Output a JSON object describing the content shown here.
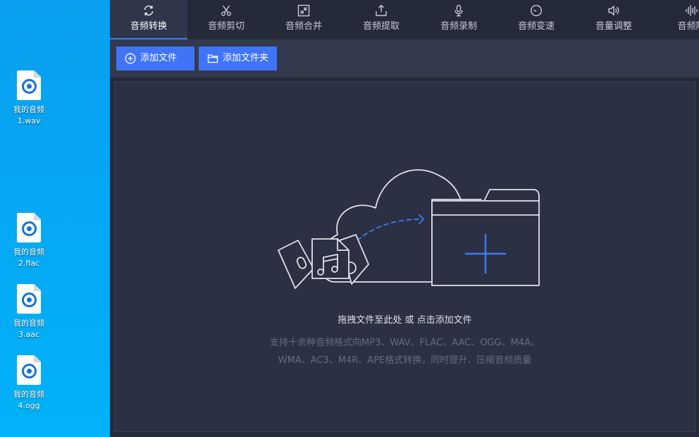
{
  "desktop": {
    "icons": [
      {
        "name": "我的音频\n1.wav"
      },
      {
        "name": "我的音频\n2.flac"
      },
      {
        "name": "我的音频\n3.aac"
      },
      {
        "name": "我的音频\n4.ogg"
      }
    ]
  },
  "tabs": [
    {
      "label": "音频转换",
      "icon": "convert-icon",
      "active": true
    },
    {
      "label": "音频剪切",
      "icon": "scissors-icon"
    },
    {
      "label": "音频合并",
      "icon": "merge-icon"
    },
    {
      "label": "音频提取",
      "icon": "extract-icon"
    },
    {
      "label": "音频录制",
      "icon": "microphone-icon"
    },
    {
      "label": "音频变速",
      "icon": "speed-icon"
    },
    {
      "label": "音量调整",
      "icon": "volume-icon"
    },
    {
      "label": "音频降",
      "icon": "waveform-icon"
    }
  ],
  "toolbar": {
    "add_file": "添加文件",
    "add_folder": "添加文件夹"
  },
  "dropzone": {
    "hint": "拖拽文件至此处 或 点击添加文件",
    "formats_line1": "支持十余种音频格式向MP3、WAV、FLAC、AAC、OGG、M4A、",
    "formats_line2": "WMA、AC3、M4R、APE格式转换，同时提升、压缩音频质量"
  },
  "colors": {
    "accent": "#3d7bff",
    "button": "#3f74f7",
    "panel": "#2b3042",
    "tabbar": "#252a38",
    "desktop": "#0aa9f0"
  }
}
